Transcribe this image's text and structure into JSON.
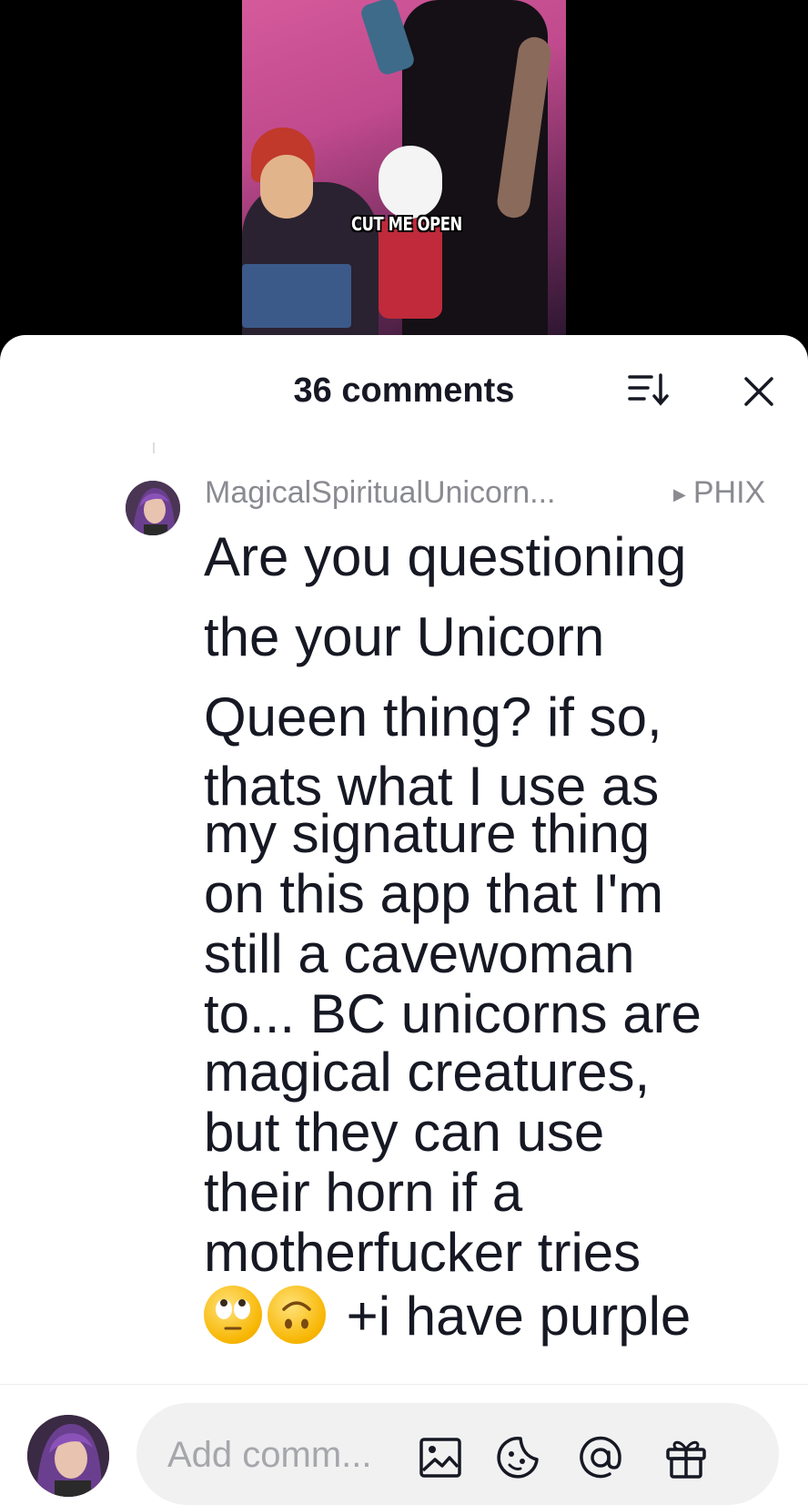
{
  "video": {
    "caption": "CUT ME OPEN"
  },
  "header": {
    "title": "36 comments",
    "icons": [
      "sort-icon",
      "close-icon"
    ]
  },
  "comment": {
    "username": "MagicalSpiritualUnicorn...",
    "reply_to": "PHIX",
    "lines": [
      "Are you questioning",
      "the your Unicorn",
      "Queen thing? if so,",
      "thats what I use as",
      "my signature thing",
      "on this app that I'm",
      "still a cavewoman",
      "to... BC unicorns are",
      "magical creatures,",
      "but they can use",
      "their horn if a",
      "motherfucker tries"
    ],
    "last_line_text": "+i have purple",
    "emojis": [
      "eye-roll-emoji",
      "upside-down-face-emoji"
    ]
  },
  "composer": {
    "placeholder": "Add comm...",
    "icons": [
      "image-icon",
      "emoji-icon",
      "mention-icon",
      "gift-icon"
    ]
  },
  "colors": {
    "text_primary": "#161823",
    "text_secondary": "#8a8b91",
    "input_bg": "#f1f1f2"
  }
}
